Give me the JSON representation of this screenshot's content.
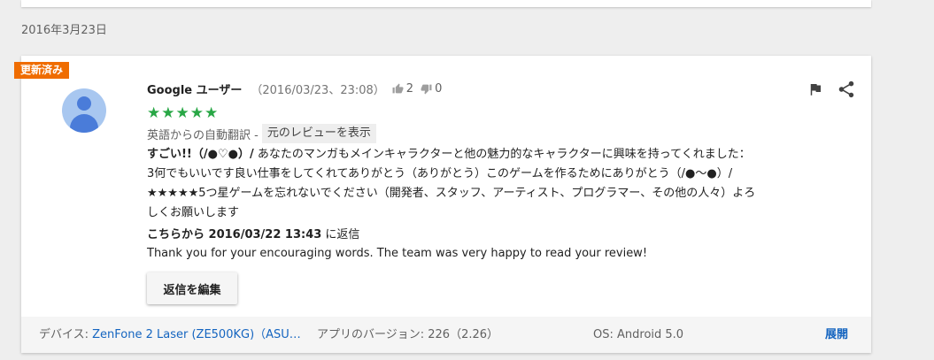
{
  "date_header": "2016年3月23日",
  "review": {
    "badge": "更新済み",
    "author": "Google ユーザー",
    "timestamp": "（2016/03/23、23:08）",
    "thumbs_up_count": "2",
    "thumbs_down_count": "0",
    "stars": "★★★★★",
    "rating": 5,
    "translation_notice": "英語からの自動翻訳 -",
    "show_original_label": "元のレビューを表示",
    "title": "すごい!!（/●♡●）/",
    "body": " あなたのマンガもメインキャラクターと他の魅力的なキャラクターに興味を持ってくれました：3何でもいいです良い仕事をしてくれてありがとう（ありがとう）このゲームを作るためにありがとう（/●〜●）/★★★★★5つ星ゲームを忘れないでください（開発者、スタッフ、アーティスト、プログラマー、その他の人々）よろしくお願いします"
  },
  "reply": {
    "heading_prefix": "こちらから 2016/03/22 13:43",
    "heading_suffix": " に返信",
    "text": "Thank you for your encouraging words. The team was very happy to read your review!",
    "edit_label": "返信を編集"
  },
  "footer": {
    "device_label": "デバイス: ",
    "device_value": "ZenFone 2 Laser (ZE500KG)（ASU…",
    "app_version": "アプリのバージョン: 226（2.26）",
    "os": "OS: Android 5.0",
    "expand_label": "展開"
  },
  "icons": {
    "flag": "flag-icon",
    "share": "share-icon",
    "thumbs_up": "thumbs-up-icon",
    "thumbs_down": "thumbs-down-icon"
  },
  "colors": {
    "badge": "#ef6c00",
    "stars": "#28a745",
    "link": "#1565c0",
    "avatar_bg": "#a8c7f0",
    "avatar_fg": "#4a7cd9"
  }
}
